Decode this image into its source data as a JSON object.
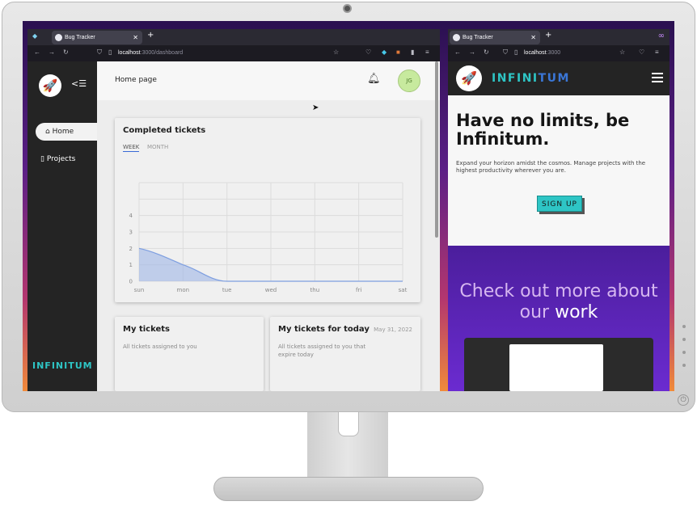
{
  "left_browser": {
    "tab_title": "Bug Tracker",
    "url_host": "localhost",
    "url_path": ":3000/dashboard"
  },
  "right_browser": {
    "tab_title": "Bug Tracker",
    "url_host": "localhost",
    "url_path": ":3000"
  },
  "app": {
    "menu_toggle": "<☰",
    "nav": {
      "home": "Home",
      "projects": "Projects"
    },
    "brand": "INFINITUM",
    "header_title": "Home page",
    "avatar_initials": "JG",
    "completed": {
      "title": "Completed tickets",
      "tab_week": "WEEK",
      "tab_month": "MONTH"
    },
    "my_tickets": {
      "title": "My tickets",
      "subtitle": "All tickets assigned to you"
    },
    "today_tickets": {
      "title": "My tickets for today",
      "date": "May 31, 2022",
      "subtitle": "All tickets assigned to you that expire today"
    }
  },
  "chart_data": {
    "type": "area",
    "categories": [
      "sun",
      "mon",
      "tue",
      "wed",
      "thu",
      "fri",
      "sat"
    ],
    "series": [
      {
        "values": [
          2,
          1,
          0,
          0,
          0,
          0,
          0
        ]
      }
    ],
    "yticks": [
      0,
      1,
      2,
      3,
      4
    ],
    "ylim": [
      0,
      6
    ],
    "grid": true,
    "color": "#9fb6e6"
  },
  "site": {
    "brand_left": "INFINI",
    "brand_right": "TUM",
    "headline": "Have no limits, be Infinitum.",
    "tagline": "Expand your horizon amidst the cosmos. Manage projects with the highest productivity wherever you are.",
    "signup": "SIGN UP",
    "work_heading_a": "Check out more about our ",
    "work_heading_b": "work"
  }
}
